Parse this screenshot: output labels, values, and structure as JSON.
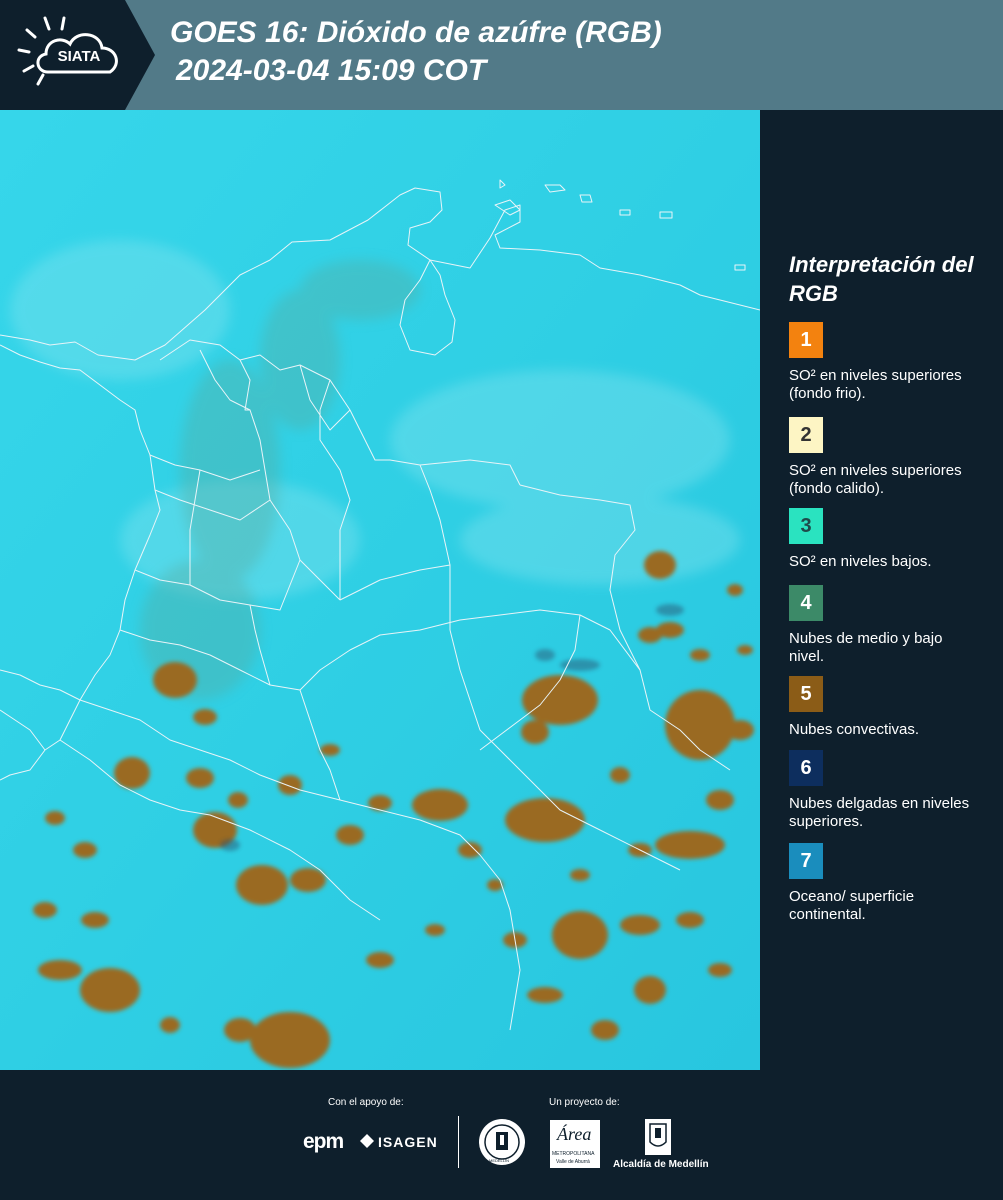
{
  "header": {
    "logo_text": "SIATA",
    "title_line1": "GOES 16: Dióxido de azúfre (RGB)",
    "title_line2": " 2024-03-04 15:09 COT",
    "background_color": "#527a88"
  },
  "legend": {
    "title": "Interpretación del RGB",
    "items": [
      {
        "number": "1",
        "color": "#f3820f",
        "number_color": "#ffffff",
        "text": "SO² en niveles superiores (fondo frio)."
      },
      {
        "number": "2",
        "color": "#fdf5c4",
        "number_color": "#333333",
        "text": "SO² en niveles superiores (fondo calido)."
      },
      {
        "number": "3",
        "color": "#2ae3c0",
        "number_color": "#1f4a4a",
        "text": "SO² en niveles bajos."
      },
      {
        "number": "4",
        "color": "#3c8a68",
        "number_color": "#ffffff",
        "text": "Nubes de medio y bajo nivel."
      },
      {
        "number": "5",
        "color": "#8b5c17",
        "number_color": "#ffffff",
        "text": "Nubes convectivas."
      },
      {
        "number": "6",
        "color": "#0d2e5e",
        "number_color": "#ffffff",
        "text": "Nubes delgadas en niveles superiores."
      },
      {
        "number": "7",
        "color": "#1a8dbd",
        "number_color": "#ffffff",
        "text": "Oceano/ superficie continental."
      }
    ]
  },
  "footer": {
    "support_label": "Con el apoyo de:",
    "project_label": "Un proyecto de:",
    "sponsor1": "epm",
    "sponsor2": "ISAGEN",
    "partner_area_name": "Área",
    "partner_area_sub": "METROPOLITANA",
    "partner_area_sub2": "Valle de Aburrá",
    "partner_alcaldia": "Alcaldía de Medellín",
    "medellin_seal_text": "MEDELLÍN"
  },
  "map": {
    "background_color": "#2bd0e6",
    "cloud_color": "#9a6a22",
    "border_color": "#e8f4f8"
  }
}
